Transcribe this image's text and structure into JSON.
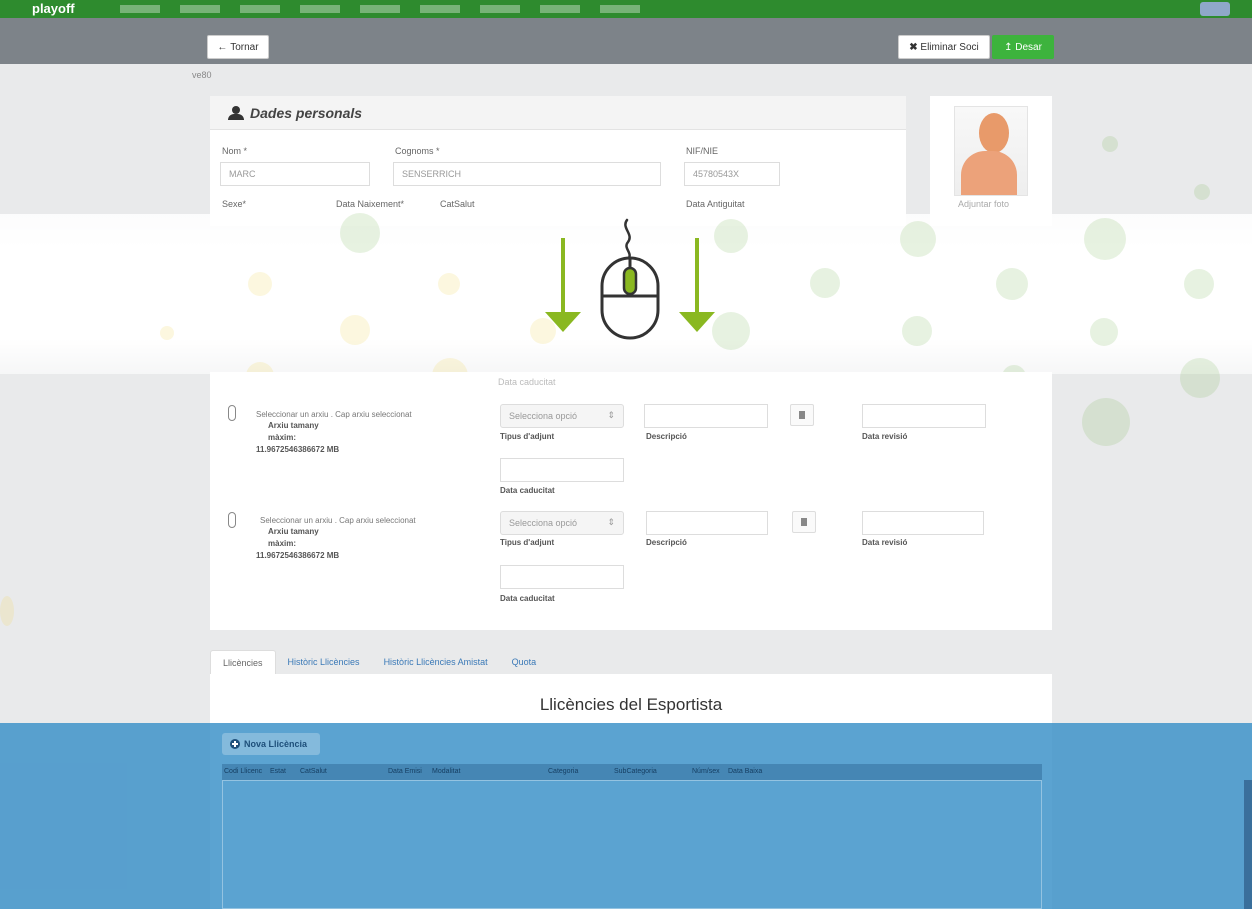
{
  "topbar": {
    "brand": "playoff"
  },
  "actions": {
    "back_label": "Tornar",
    "delete_label": "Eliminar Soci",
    "save_label": "Desar"
  },
  "breadcrumb": "ve80",
  "personal": {
    "title": "Dades personals",
    "fields": {
      "nom_label": "Nom *",
      "nom_value": "MARC",
      "cognoms_label": "Cognoms *",
      "cognoms_value": "SENSERRICH",
      "nif_label": "NIF/NIE",
      "nif_value": "45780543X",
      "sexe_label": "Sexe*",
      "naix_label": "Data Naixement*",
      "catsalut_label": "CatSalut",
      "antiguitat_label": "Data Antiguitat"
    },
    "photo_link": "Adjuntar foto"
  },
  "attachments": {
    "top_caducitat": "Data caducitat",
    "rows": [
      {
        "file_text": "Seleccionar un arxiu . Cap arxiu seleccionat",
        "size_label": "Arxiu tamany",
        "size_max": "màxim:",
        "size_value": "11.9672546386672 MB",
        "select_value": "Selecciona opció",
        "tipus_label": "Tipus d'adjunt",
        "descripcio_label": "Descripció",
        "revisio_label": "Data revisió",
        "caducitat_label": "Data caducitat"
      },
      {
        "file_text": "Seleccionar un arxiu . Cap arxiu seleccionat",
        "size_label": "Arxiu tamany",
        "size_max": "màxim:",
        "size_value": "11.9672546386672 MB",
        "select_value": "Selecciona opció",
        "tipus_label": "Tipus d'adjunt",
        "descripcio_label": "Descripció",
        "revisio_label": "Data revisió",
        "caducitat_label": "Data caducitat"
      }
    ]
  },
  "tabs": [
    "Llicències",
    "Històric Llicències",
    "Històric Llicències Amistat",
    "Quota"
  ],
  "licences": {
    "title": "Llicències del Esportista",
    "new_button": "Nova Llicència",
    "columns": [
      "Codi Llicenc",
      "Estat",
      "CatSalut",
      "Data Emisi",
      "Modalitat",
      "Categoria",
      "SubCategoria",
      "Núm/sex",
      "Data Baixa"
    ]
  },
  "colors": {
    "brand_green": "#2e8b2e",
    "save_green": "#3db33d",
    "arrow_green": "#8ab821",
    "overlay_blue": "#3c91c8"
  },
  "icons": [
    "user-icon",
    "paperclip-icon",
    "trash-icon",
    "plus-circle-icon",
    "mouse-scroll-icon",
    "arrow-down-icon"
  ]
}
